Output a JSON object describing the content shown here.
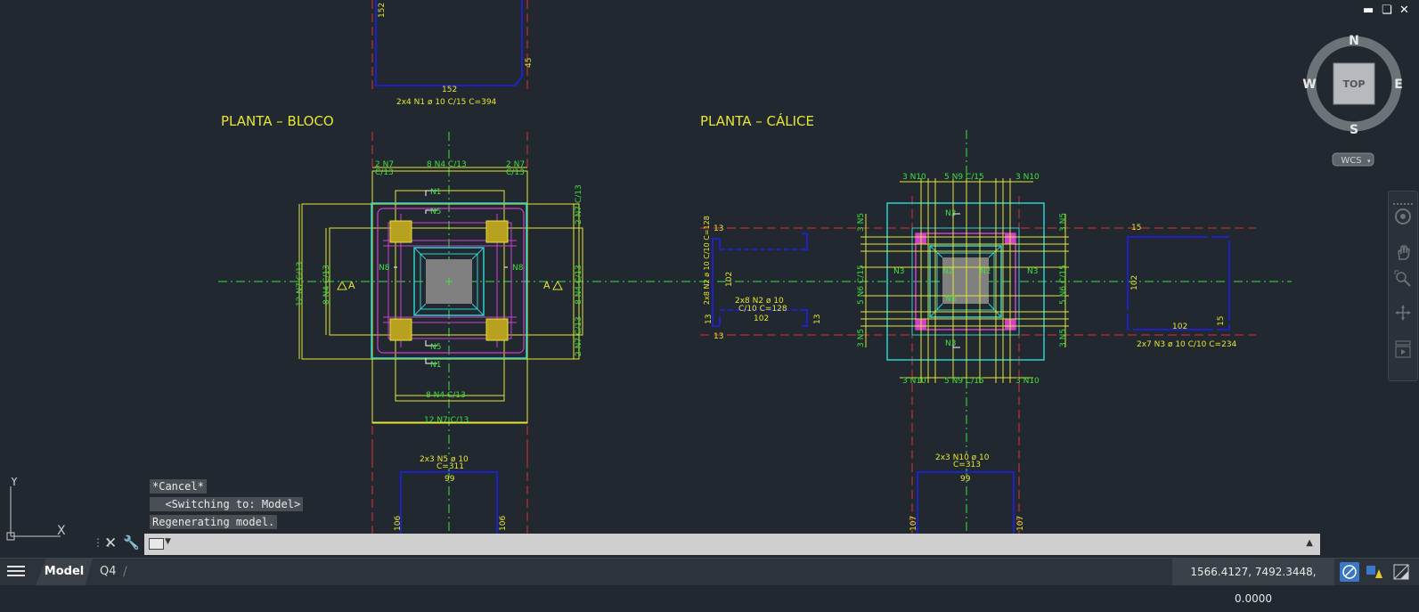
{
  "window": {
    "minimize_icon": "minimize-icon",
    "restore_icon": "restore-icon",
    "close_icon": "close-icon"
  },
  "drawing": {
    "titles": {
      "bloco": "PLANTA  –  BLOCO",
      "calice": "PLANTA  –  CÁLICE"
    },
    "bloco": {
      "top_detail_label": "2x4 N1 ø 10 C/15 C=394",
      "top_detail_dim_w": "152",
      "top_detail_dim_h": "152",
      "top_detail_dim_side": "45",
      "n7_tl": "2 N7",
      "n7_tl_sp": "C/13",
      "n4_top": "8 N4 C/13",
      "n7_tr": "2 N7",
      "n7_tr_sp": "C/13",
      "n1_top": "N1",
      "n5_top": "N5",
      "n8_left": "N8",
      "n8_right": "N8",
      "n5_bot": "N5",
      "n1_bot": "N1",
      "left_n7": "12 N7 C/13",
      "left_n4": "8 N4 C/13",
      "right_n7_top": "2 N7 C/13",
      "right_n4": "8 N4 C/13",
      "right_n7_bot": "2 N7 C/13",
      "section_a": "A",
      "bot_n4": "8 N4 C/13",
      "bot_n7": "12 N7 C/13",
      "bottom_detail_label_1": "2x3 N5 ø 10",
      "bottom_detail_label_2": "C=311",
      "bottom_detail_dim_w": "99",
      "bottom_detail_dim_left": "106",
      "bottom_detail_dim_right": "106"
    },
    "left_detail": {
      "dim_13_tl": "13",
      "dim_13_bl": "13",
      "dim_13_left": "13",
      "dim_13_right": "13",
      "dim_102_v": "102",
      "dim_102_h": "102",
      "label_vert": "2x8 N2 ø 10 C/10 C=128",
      "label_1": "2x8 N2 ø 10",
      "label_2": "C/10 C=128"
    },
    "calice": {
      "n10_tl": "3 N10",
      "n9_top": "5 N9 C/15",
      "n10_tr": "3 N10",
      "n3_top": "N3",
      "n3_left": "N3",
      "n2_left": "N2",
      "n2_right": "N2",
      "n3_right": "N3",
      "n3_mid": "N3",
      "n3_bot": "N3",
      "left_n5_top": "3 N5",
      "left_n6": "5 N6 C/15",
      "left_n5_bot": "3 N5",
      "right_n5_top": "3 N5",
      "right_n6": "5 N6 C/15",
      "right_n5_bot": "3 N5",
      "n10_bl": "3 N10",
      "n9_bot": "5 N9 C/15",
      "n10_br": "3 N10",
      "bottom_detail_label_1": "2x3 N10 ø 10",
      "bottom_detail_label_2": "C=313",
      "bottom_detail_dim_w": "99",
      "bottom_detail_dim_left": "107",
      "bottom_detail_dim_right": "107"
    },
    "right_detail": {
      "dim_15_top": "15",
      "dim_15_side": "15",
      "dim_102_v": "102",
      "dim_102_h": "102",
      "label": "2x7 N3 ø 10 C/10 C=234"
    }
  },
  "viewcube": {
    "north": "N",
    "south": "S",
    "east": "E",
    "west": "W",
    "face": "TOP",
    "ucs": "WCS"
  },
  "ucs_icon": {
    "y": "Y",
    "x": "X"
  },
  "command": {
    "history": [
      "*Cancel*",
      "  <Switching to: Model>",
      "Regenerating model."
    ],
    "placeholder": ""
  },
  "status_bar": {
    "tabs": [
      {
        "label": "Model"
      },
      {
        "label": "Q4"
      }
    ],
    "coordinates": "1566.4127, 7492.3448, 0.0000"
  },
  "colors": {
    "background": "#212830",
    "yellow": "#e6e632",
    "green": "#3ee03e",
    "cyan": "#2fd0d0",
    "magenta": "#d23cd2",
    "red": "#e03030",
    "blue": "#2020c8",
    "gray_fill": "#808080"
  }
}
